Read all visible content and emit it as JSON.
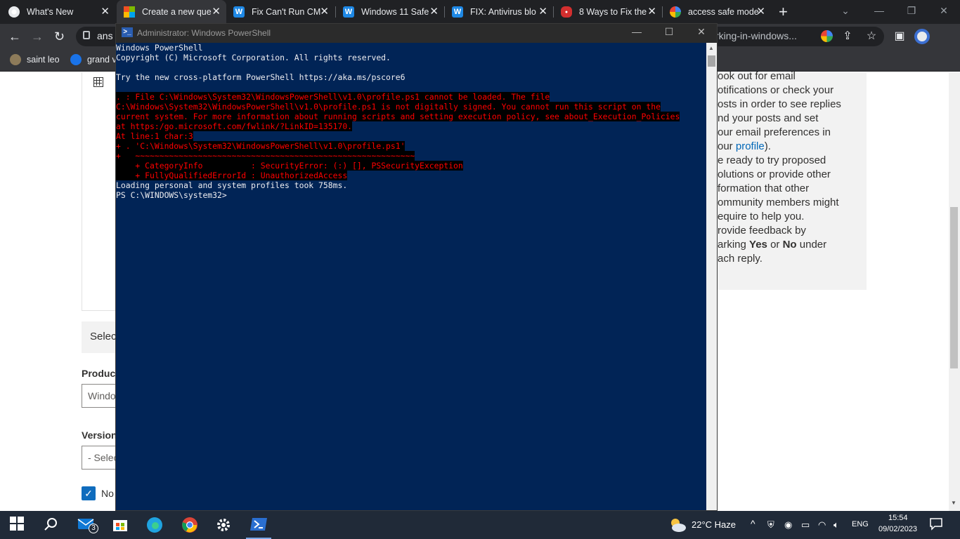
{
  "browser": {
    "tabs": [
      {
        "title": "What's New",
        "active": false,
        "icon": "chrome-icon"
      },
      {
        "title": "Create a new que",
        "active": true,
        "icon": "microsoft-icon"
      },
      {
        "title": "Fix Can't Run CM",
        "active": false,
        "icon": "windowsreport-icon"
      },
      {
        "title": "Windows 11 Safe",
        "active": false,
        "icon": "windowsreport-icon"
      },
      {
        "title": "FIX: Antivirus blo",
        "active": false,
        "icon": "windowsreport-icon"
      },
      {
        "title": "8 Ways to Fix the",
        "active": false,
        "icon": "red-site-icon"
      },
      {
        "title": "access safe mode",
        "active": false,
        "icon": "google-icon"
      }
    ],
    "tab_close": "✕",
    "new_tab": "+",
    "url_left": "ans",
    "url_right": "rking-in-windows...",
    "bookmarks": [
      "saint leo",
      "grand v"
    ]
  },
  "page": {
    "select_text": "Selec",
    "product_label": "Product",
    "product_value": "Windo",
    "version_label": "Version",
    "version_value": "- Selec",
    "checkbox_label": "No",
    "tips_lines": [
      "ook out for email",
      "otifications or check your",
      "osts in order to see replies",
      "nd your posts and set",
      "our email preferences in",
      "",
      "e ready to try proposed",
      "olutions or provide other",
      "formation that other",
      "ommunity members might",
      "equire to help you.",
      "rovide feedback by",
      "",
      "ach reply."
    ],
    "tips_profile_prefix": "our ",
    "tips_profile_link": "profile",
    "tips_profile_suffix": ").",
    "tips_mark_prefix": "arking ",
    "tips_yes": "Yes",
    "tips_or": " or ",
    "tips_no": "No",
    "tips_mark_suffix": " under"
  },
  "powershell": {
    "title": "Administrator: Windows PowerShell",
    "lines": [
      {
        "text": "Windows PowerShell",
        "type": "normal"
      },
      {
        "text": "Copyright (C) Microsoft Corporation. All rights reserved.",
        "type": "normal"
      },
      {
        "text": "",
        "type": "normal"
      },
      {
        "text": "Try the new cross-platform PowerShell https://aka.ms/pscore6",
        "type": "normal"
      },
      {
        "text": "",
        "type": "normal"
      },
      {
        "text": ". : File C:\\Windows\\System32\\WindowsPowerShell\\v1.0\\profile.ps1 cannot be loaded. The file",
        "type": "error"
      },
      {
        "text": "C:\\Windows\\System32\\WindowsPowerShell\\v1.0\\profile.ps1 is not digitally signed. You cannot run this script on the",
        "type": "error"
      },
      {
        "text": "current system. For more information about running scripts and setting execution policy, see about_Execution_Policies",
        "type": "error"
      },
      {
        "text": "at https:/go.microsoft.com/fwlink/?LinkID=135170.",
        "type": "error"
      },
      {
        "text": "At line:1 char:3",
        "type": "error"
      },
      {
        "text": "+ . 'C:\\Windows\\System32\\WindowsPowerShell\\v1.0\\profile.ps1'",
        "type": "error"
      },
      {
        "text": "+   ~~~~~~~~~~~~~~~~~~~~~~~~~~~~~~~~~~~~~~~~~~~~~~~~~~~~~~~~~~",
        "type": "error"
      },
      {
        "text": "    + CategoryInfo          : SecurityError: (:) [], PSSecurityException",
        "type": "error"
      },
      {
        "text": "    + FullyQualifiedErrorId : UnauthorizedAccess",
        "type": "error"
      },
      {
        "text": "Loading personal and system profiles took 758ms.",
        "type": "normal"
      },
      {
        "text": "PS C:\\WINDOWS\\system32>",
        "type": "normal"
      }
    ]
  },
  "taskbar": {
    "mail_badge": "3",
    "weather": "22°C  Haze",
    "language": "ENG",
    "time": "15:54",
    "date": "09/02/2023"
  },
  "colors": {
    "ps_background": "#012456",
    "error_text": "#ff0000",
    "taskbar": "#202a38"
  }
}
